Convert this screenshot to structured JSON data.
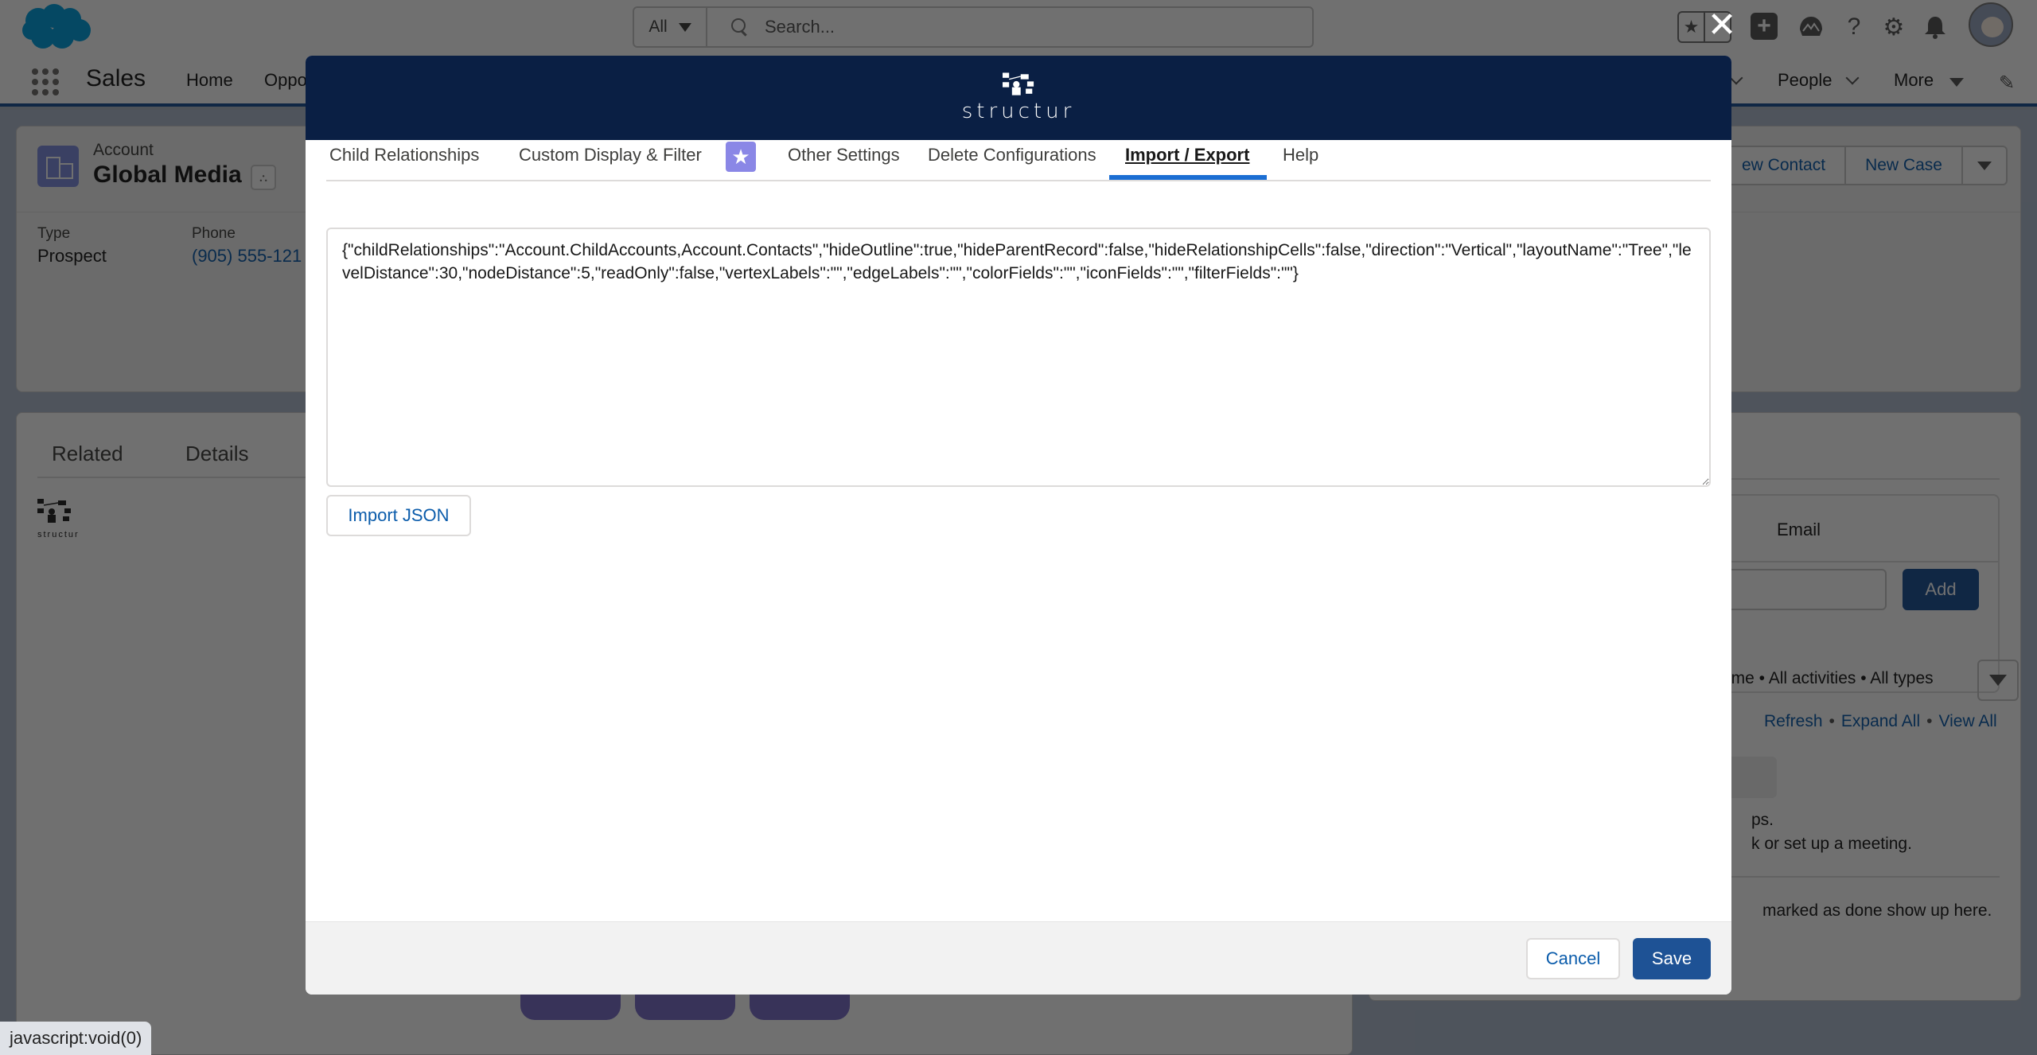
{
  "global_header": {
    "search_scope": "All",
    "search_placeholder": "Search...",
    "close_glyph": "✕",
    "icons": [
      "favorites-star-icon",
      "add-plus-icon",
      "trailhead-icon",
      "help-icon",
      "setup-gear-icon",
      "notifications-bell-icon",
      "user-avatar"
    ]
  },
  "nav": {
    "app_name": "Sales",
    "items": [
      {
        "label": "Home"
      },
      {
        "label": "Oppo"
      },
      {
        "label": "People"
      },
      {
        "label": "More"
      }
    ]
  },
  "record": {
    "object_type": "Account",
    "name": "Global Media",
    "fields": [
      {
        "label": "Type",
        "value": "Prospect"
      },
      {
        "label": "Phone",
        "value": "(905) 555-121"
      }
    ],
    "actions": [
      "ew Contact",
      "New Case"
    ]
  },
  "related_card": {
    "tabs": [
      "Related",
      "Details"
    ],
    "brand_word": "structur"
  },
  "activity": {
    "email_tab": "Email",
    "add_label": "Add",
    "filter_text": "ime • All activities • All types",
    "links": [
      "Refresh",
      "Expand All",
      "View All"
    ],
    "line1": "ps.",
    "line2": "k or set up a meeting.",
    "line3": "marked as done show up here."
  },
  "modal": {
    "brand_word": "structur",
    "tabs": [
      {
        "label": "Child Relationships",
        "active": false
      },
      {
        "label": "Custom Display & Filter",
        "active": false,
        "badge": "star-icon"
      },
      {
        "label": "Other Settings",
        "active": false
      },
      {
        "label": "Delete Configurations",
        "active": false
      },
      {
        "label": "Import / Export",
        "active": true
      },
      {
        "label": "Help",
        "active": false
      }
    ],
    "json_text": "{\"childRelationships\":\"Account.ChildAccounts,Account.Contacts\",\"hideOutline\":true,\"hideParentRecord\":false,\"hideRelationshipCells\":false,\"direction\":\"Vertical\",\"layoutName\":\"Tree\",\"levelDistance\":30,\"nodeDistance\":5,\"readOnly\":false,\"vertexLabels\":\"\",\"edgeLabels\":\"\",\"colorFields\":\"\",\"iconFields\":\"\",\"filterFields\":\"\"}",
    "import_button": "Import JSON",
    "cancel_button": "Cancel",
    "save_button": "Save"
  },
  "colors": {
    "modal_header": "#0a1f44",
    "active_tab_underline": "#1b6ed3",
    "brand_button": "#1e5295",
    "link": "#0b5cab",
    "star_badge": "#8a87e6"
  },
  "status_bar": {
    "text": "javascript:void(0)"
  }
}
